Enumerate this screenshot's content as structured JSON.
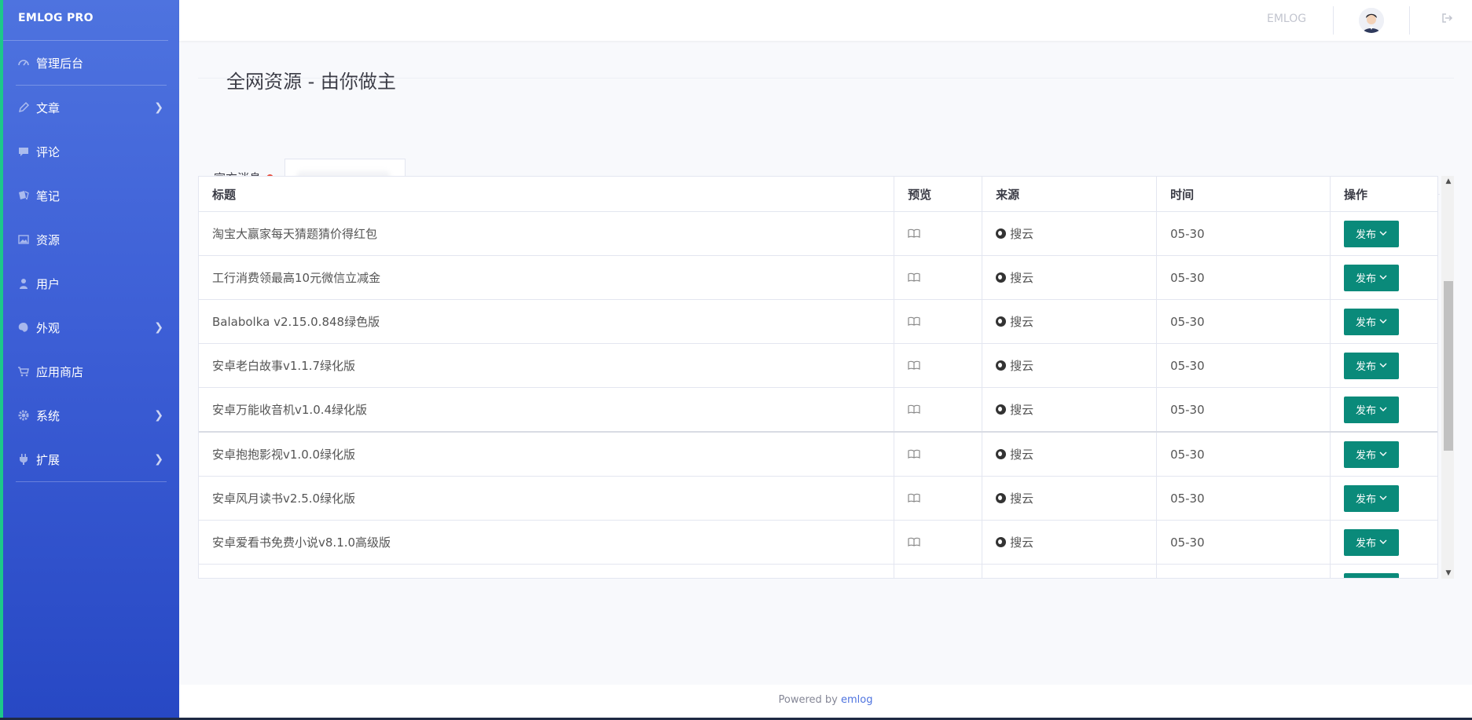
{
  "brand": "EMLOG PRO",
  "sidebar": {
    "items": [
      {
        "label": "管理后台",
        "icon": "dashboard-icon",
        "has_children": false
      },
      {
        "label": "文章",
        "icon": "pencil-icon",
        "has_children": true
      },
      {
        "label": "评论",
        "icon": "comment-icon",
        "has_children": false
      },
      {
        "label": "笔记",
        "icon": "note-icon",
        "has_children": false
      },
      {
        "label": "资源",
        "icon": "image-icon",
        "has_children": false
      },
      {
        "label": "用户",
        "icon": "user-icon",
        "has_children": false
      },
      {
        "label": "外观",
        "icon": "palette-icon",
        "has_children": true
      },
      {
        "label": "应用商店",
        "icon": "cart-icon",
        "has_children": false
      },
      {
        "label": "系统",
        "icon": "gear-icon",
        "has_children": true
      },
      {
        "label": "扩展",
        "icon": "plug-icon",
        "has_children": true
      }
    ]
  },
  "topbar": {
    "site_link": "EMLOG"
  },
  "page": {
    "title": "全网资源 - 由你做主",
    "tabs": [
      {
        "label": "官方消息",
        "has_dot": true
      },
      {
        "label": "",
        "blurred": true
      }
    ]
  },
  "table": {
    "headers": {
      "title": "标题",
      "preview": "预览",
      "source": "来源",
      "time": "时间",
      "action": "操作"
    },
    "rows": [
      {
        "title": "淘宝大赢家每天猜题猜价得红包",
        "source": "搜云",
        "time": "05-30"
      },
      {
        "title": "工行消费领最高10元微信立减金",
        "source": "搜云",
        "time": "05-30"
      },
      {
        "title": "Balabolka v2.15.0.848绿色版",
        "source": "搜云",
        "time": "05-30"
      },
      {
        "title": "安卓老白故事v1.1.7绿化版",
        "source": "搜云",
        "time": "05-30"
      },
      {
        "title": "安卓万能收音机v1.0.4绿化版",
        "source": "搜云",
        "time": "05-30"
      },
      {
        "title": "安卓抱抱影视v1.0.0绿化版",
        "source": "搜云",
        "time": "05-30"
      },
      {
        "title": "安卓风月读书v2.5.0绿化版",
        "source": "搜云",
        "time": "05-30"
      },
      {
        "title": "安卓爱看书免费小说v8.1.0高级版",
        "source": "搜云",
        "time": "05-30"
      },
      {
        "title": "",
        "source": "",
        "time": ""
      }
    ],
    "publish_label": "发布"
  },
  "footer": {
    "text": "Powered by",
    "link": "emlog"
  },
  "colors": {
    "sidebar": "#4e73df",
    "publish_button": "#0a8a7a",
    "notify_dot": "#e74a3b"
  }
}
